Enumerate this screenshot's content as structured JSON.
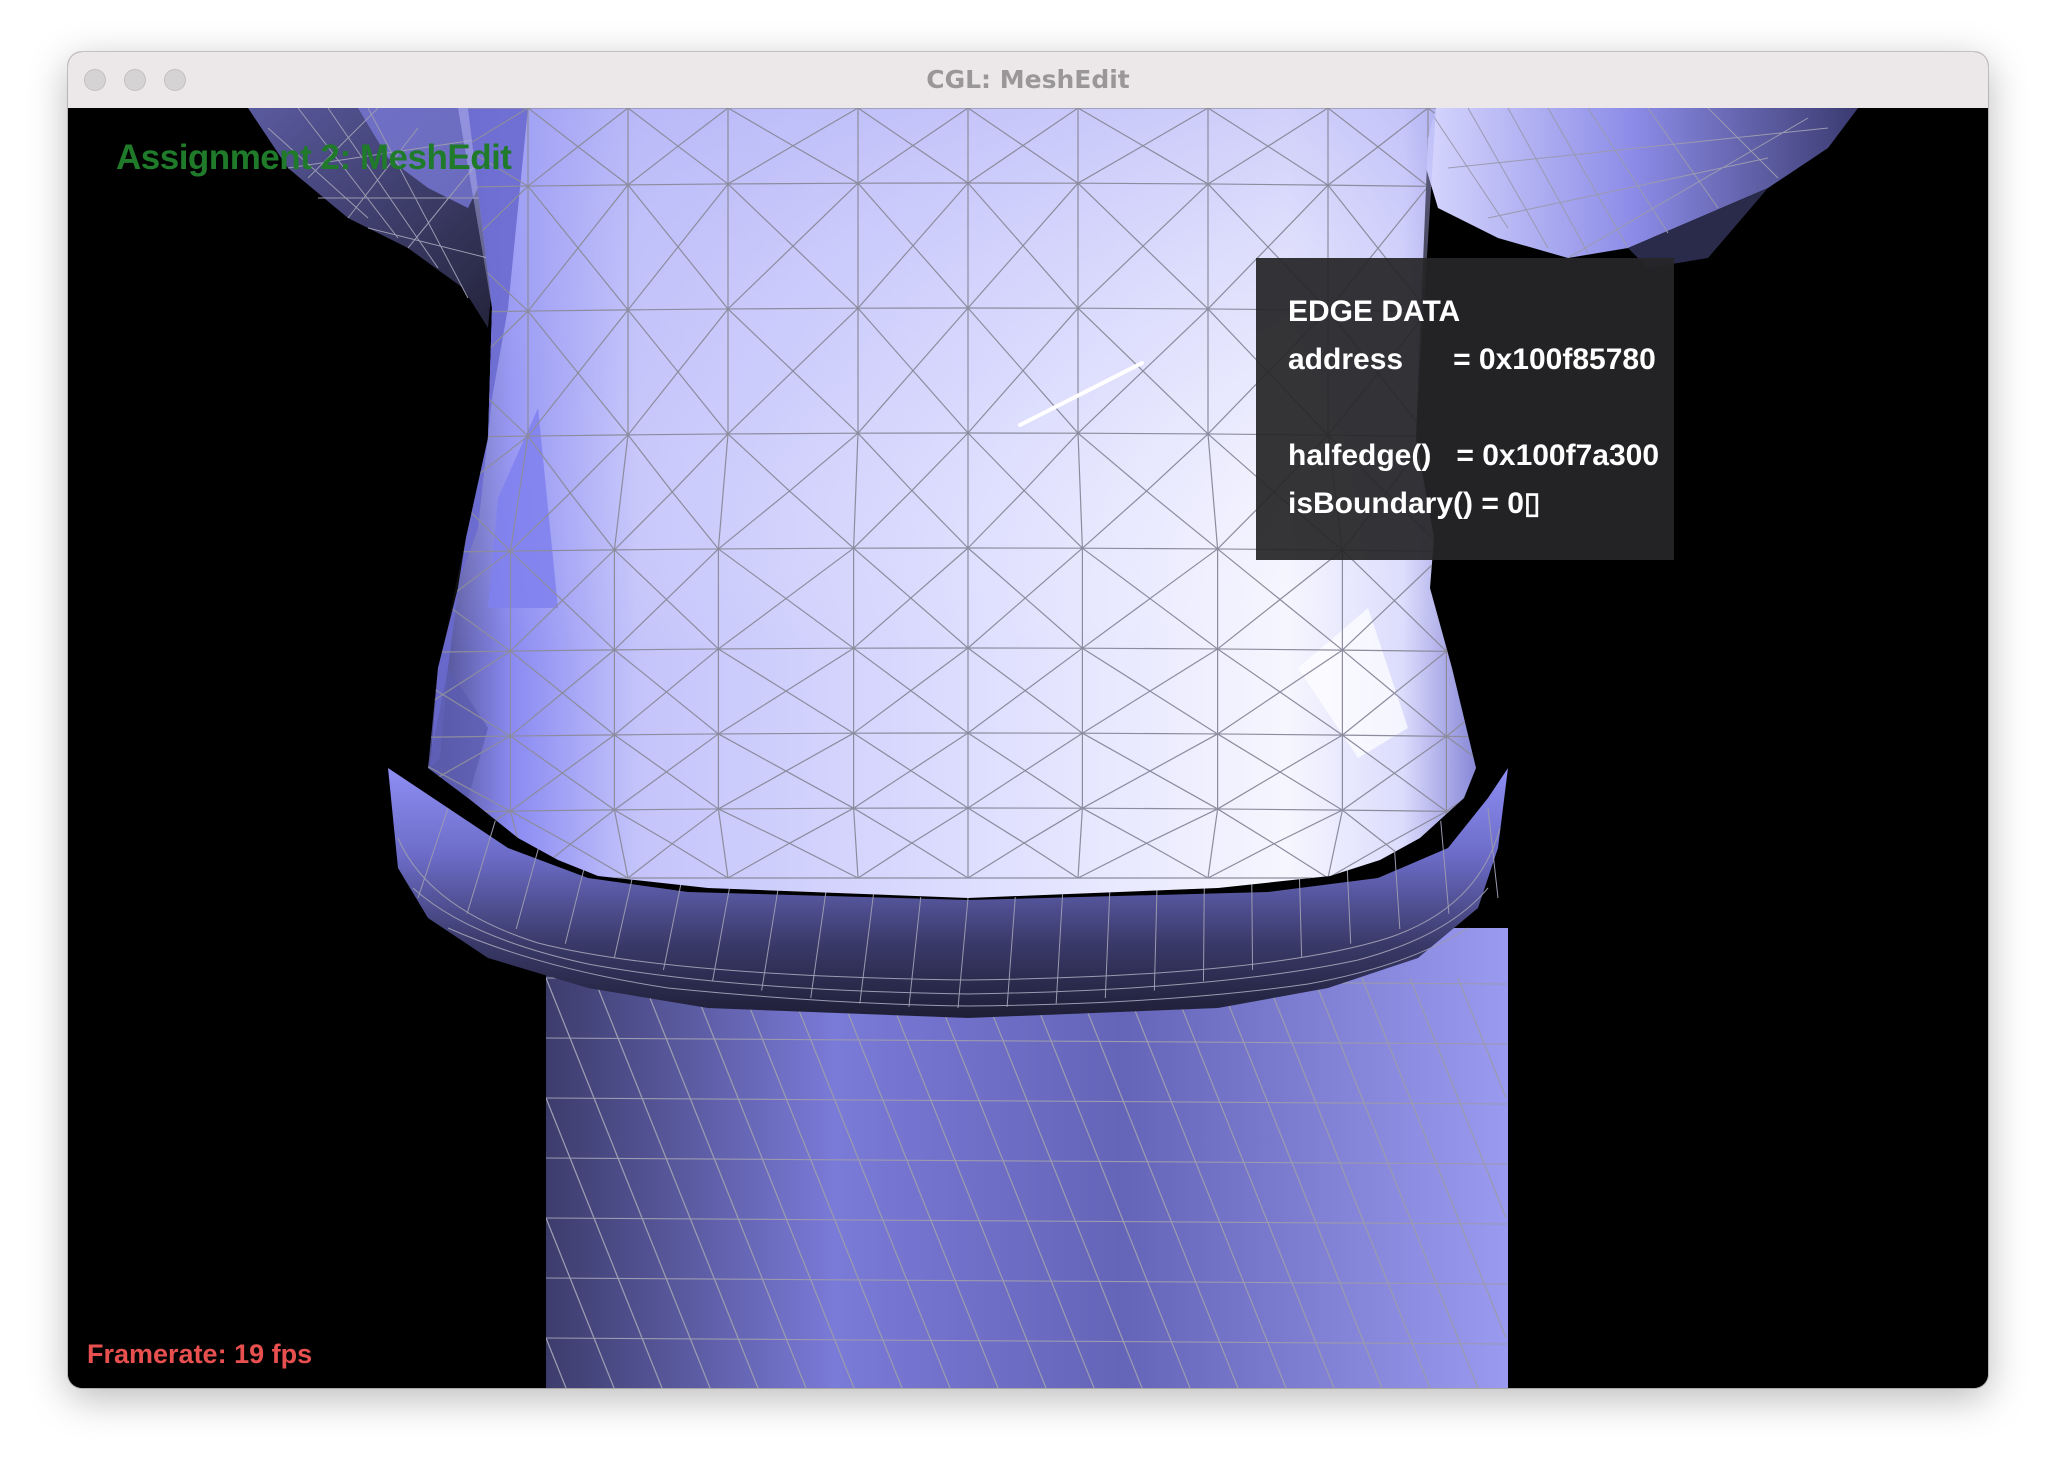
{
  "window": {
    "title": "CGL: MeshEdit"
  },
  "overlay": {
    "app_title": "Assignment 2: MeshEdit",
    "framerate": "Framerate: 19 fps"
  },
  "edge_data": {
    "heading": "EDGE DATA",
    "address": "address      = 0x100f85780",
    "halfedge": "halfedge()   = 0x100f7a300",
    "is_boundary": "isBoundary() = 0▯"
  },
  "colors": {
    "background": "#000000",
    "mesh_light": "#eeeeff",
    "mesh_mid": "#bcbcf8",
    "mesh_dark": "#2a2a4a",
    "wireframe": "#8a8a9a",
    "selected_edge": "#ffffff",
    "app_title": "#1f7a2a",
    "framerate": "#e8504f"
  }
}
